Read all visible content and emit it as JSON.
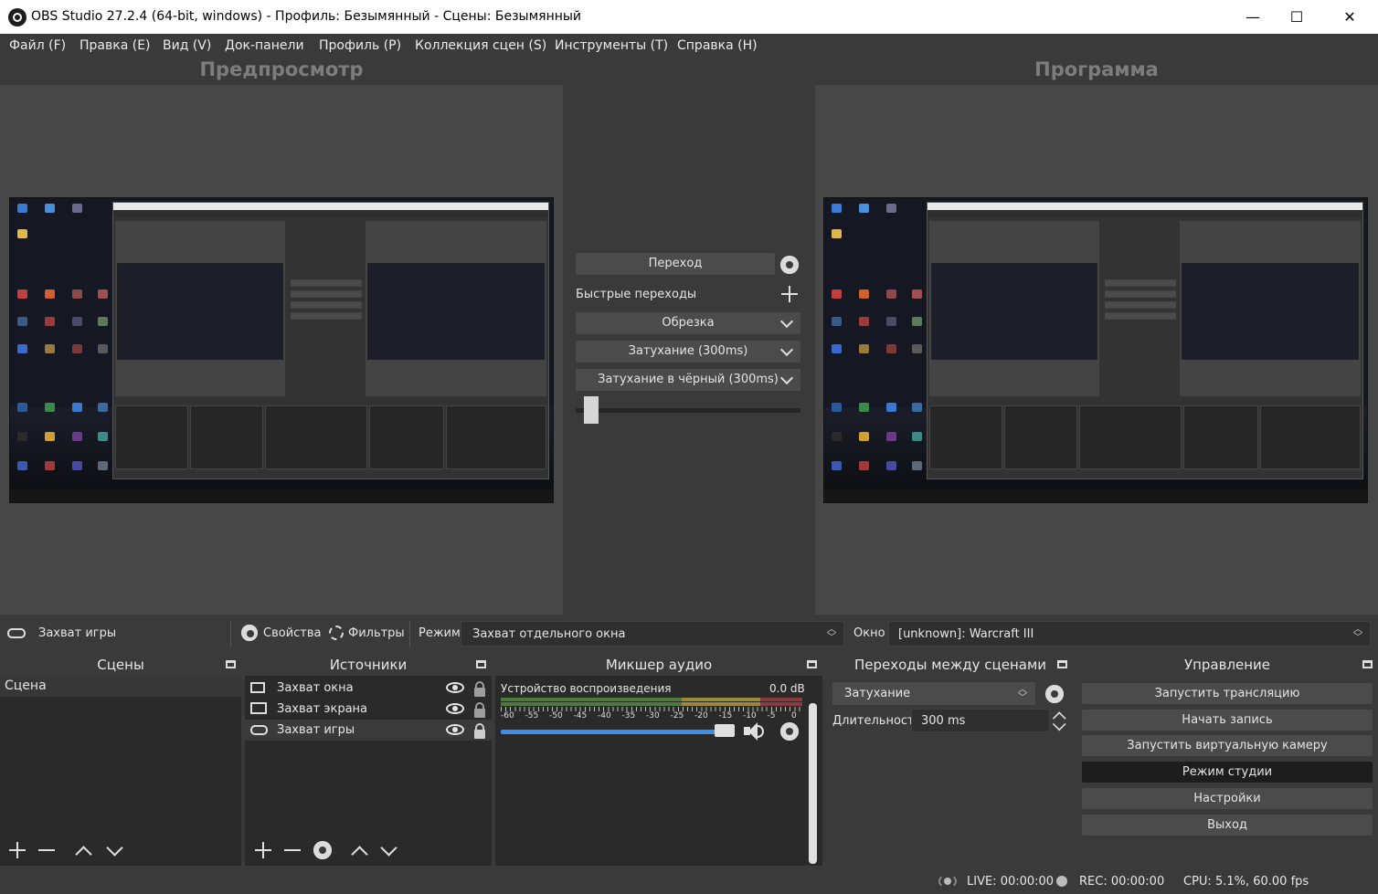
{
  "window": {
    "title": "OBS Studio 27.2.4 (64-bit, windows) - Профиль: Безымянный - Сцены: Безымянный",
    "minimize": "—",
    "maximize": "☐",
    "close": "✕"
  },
  "menu": [
    "Файл (F)",
    "Правка (E)",
    "Вид (V)",
    "Док-панели",
    "Профиль (P)",
    "Коллекция сцен (S)",
    "Инструменты (T)",
    "Справка (H)"
  ],
  "preview": {
    "title": "Предпросмотр"
  },
  "program": {
    "title": "Программа"
  },
  "transitions_mid": {
    "transition_button": "Переход",
    "quick_label": "Быстрые переходы",
    "items": [
      "Обрезка",
      "Затухание (300ms)",
      "Затухание в чёрный (300ms)"
    ],
    "tbar_level": 0.04
  },
  "source_toolbar": {
    "source_name": "Захват игры",
    "properties": "Свойства",
    "filters": "Фильтры",
    "mode_label": "Режим",
    "mode_value": "Захват отдельного окна",
    "window_label": "Окно",
    "window_value": "[unknown]: Warcraft III"
  },
  "scenes": {
    "title": "Сцены",
    "items": [
      "Сцена"
    ]
  },
  "sources": {
    "title": "Источники",
    "items": [
      "Захват окна",
      "Захват экрана",
      "Захват игры"
    ]
  },
  "mixer": {
    "title": "Микшер аудио",
    "device": "Устройство воспроизведения",
    "db": "0.0 dB",
    "scale": [
      "-60",
      "-55",
      "-50",
      "-45",
      "-40",
      "-35",
      "-30",
      "-25",
      "-20",
      "-15",
      "-10",
      "-5",
      "0"
    ],
    "volume": 1.0
  },
  "scene_transitions": {
    "title": "Переходы между сценами",
    "selected": "Затухание",
    "duration_label": "Длительность",
    "duration_value": "300 ms"
  },
  "controls": {
    "title": "Управление",
    "buttons": [
      "Запустить трансляцию",
      "Начать запись",
      "Запустить виртуальную камеру",
      "Режим студии",
      "Настройки",
      "Выход"
    ]
  },
  "status": {
    "live": "LIVE: 00:00:00",
    "rec": "REC: 00:00:00",
    "cpu": "CPU: 5.1%, 60.00 fps"
  }
}
